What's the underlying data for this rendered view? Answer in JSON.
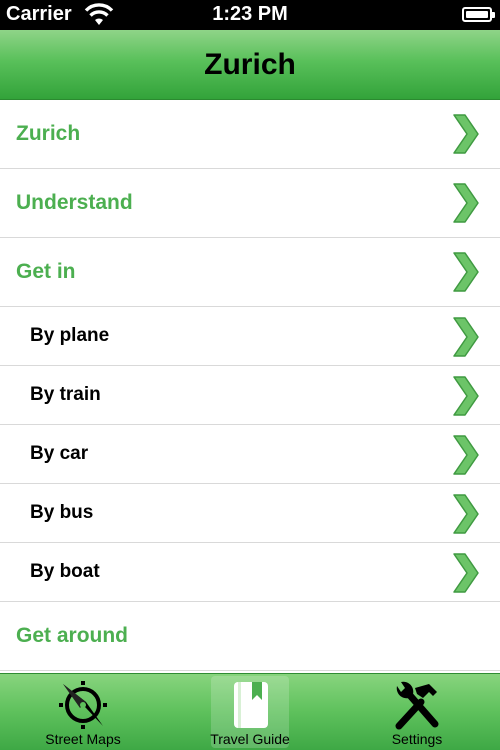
{
  "status_bar": {
    "carrier": "Carrier",
    "time": "1:23 PM"
  },
  "nav": {
    "title": "Zurich"
  },
  "colors": {
    "accent_green": "#4caf50",
    "bar_green": "#59c05a"
  },
  "list": {
    "rows": [
      {
        "label": "Zurich",
        "level": "section"
      },
      {
        "label": "Understand",
        "level": "section"
      },
      {
        "label": "Get in",
        "level": "section"
      },
      {
        "label": "By plane",
        "level": "sub"
      },
      {
        "label": "By train",
        "level": "sub"
      },
      {
        "label": "By car",
        "level": "sub"
      },
      {
        "label": "By bus",
        "level": "sub"
      },
      {
        "label": "By boat",
        "level": "sub"
      },
      {
        "label": "Get around",
        "level": "section"
      }
    ]
  },
  "tab_bar": {
    "tabs": [
      {
        "label": "Street Maps",
        "icon": "compass-icon"
      },
      {
        "label": "Travel Guide",
        "icon": "book-icon",
        "selected": true
      },
      {
        "label": "Settings",
        "icon": "tools-icon"
      }
    ]
  }
}
